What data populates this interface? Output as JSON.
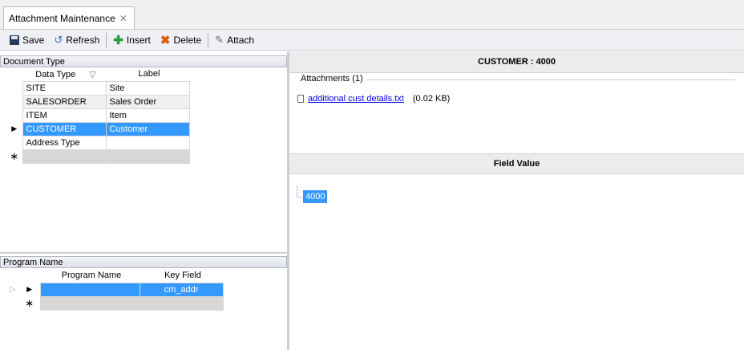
{
  "tab": {
    "title": "Attachment Maintenance",
    "close_glyph": "✕"
  },
  "toolbar": {
    "save_label": "Save",
    "refresh_label": "Refresh",
    "insert_label": "Insert",
    "delete_label": "Delete",
    "attach_label": "Attach"
  },
  "document_type": {
    "header": "Document Type",
    "col_data_type": "Data Type",
    "col_label": "Label",
    "rows": [
      {
        "data_type": "SITE",
        "label": "Site"
      },
      {
        "data_type": "SALESORDER",
        "label": "Sales Order"
      },
      {
        "data_type": "ITEM",
        "label": "Item"
      },
      {
        "data_type": "CUSTOMER",
        "label": "Customer"
      },
      {
        "data_type": "Address Type",
        "label": ""
      }
    ],
    "selected_index": 3
  },
  "program_name": {
    "header": "Program Name",
    "col_program": "Program Name",
    "col_key": "Key Field",
    "rows": [
      {
        "program": "",
        "key": "cm_addr"
      }
    ]
  },
  "detail": {
    "title": "CUSTOMER : 4000",
    "attachments_label": "Attachments (1)",
    "file_name": "additional cust details.txt",
    "file_size": "(0.02 KB)",
    "field_value_header": "Field Value",
    "field_value": "4000"
  },
  "colors": {
    "selection": "#3399ff",
    "link": "#0000ee"
  }
}
